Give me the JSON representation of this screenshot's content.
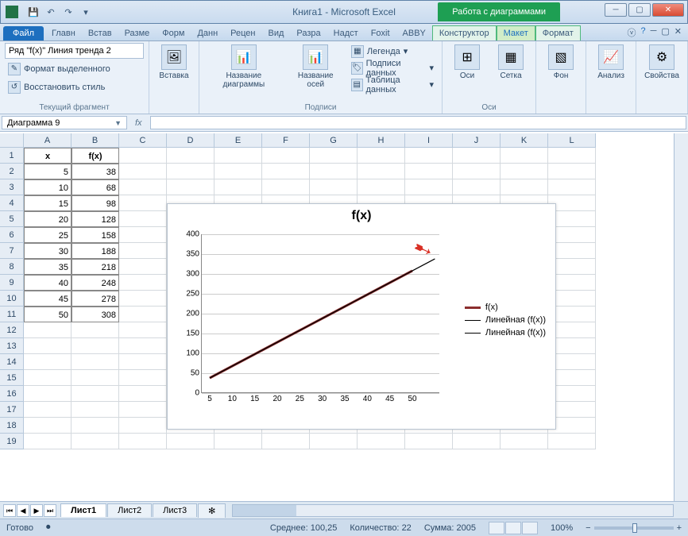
{
  "window": {
    "book": "Книга1",
    "app": "Microsoft Excel",
    "chart_tools": "Работа с диаграммами"
  },
  "tabs": {
    "file": "Файл",
    "list": [
      "Главн",
      "Встав",
      "Разме",
      "Форм",
      "Данн",
      "Рецен",
      "Вид",
      "Разра",
      "Надст",
      "Foxit",
      "ABBY"
    ],
    "chart": [
      "Конструктор",
      "Макет",
      "Формат"
    ],
    "active": "Макет"
  },
  "ribbon": {
    "sel_value": "Ряд \"f(x)\" Линия тренда 2",
    "format_sel": "Формат выделенного",
    "reset_style": "Восстановить стиль",
    "g1": "Текущий фрагмент",
    "insert": "Вставка",
    "chart_name": "Название диаграммы",
    "axes_name": "Название осей",
    "legend": "Легенда",
    "data_labels": "Подписи данных",
    "data_table": "Таблица данных",
    "g2": "Подписи",
    "axes": "Оси",
    "grid": "Сетка",
    "g3": "Оси",
    "bg": "Фон",
    "analysis": "Анализ",
    "props": "Свойства"
  },
  "namebox": "Диаграмма 9",
  "fx": "fx",
  "cols": [
    "A",
    "B",
    "C",
    "D",
    "E",
    "F",
    "G",
    "H",
    "I",
    "J",
    "K",
    "L"
  ],
  "rows": [
    "1",
    "2",
    "3",
    "4",
    "5",
    "6",
    "7",
    "8",
    "9",
    "10",
    "11",
    "12",
    "13",
    "14",
    "15",
    "16",
    "17",
    "18",
    "19"
  ],
  "table": {
    "h1": "x",
    "h2": "f(x)",
    "data": [
      [
        5,
        38
      ],
      [
        10,
        68
      ],
      [
        15,
        98
      ],
      [
        20,
        128
      ],
      [
        25,
        158
      ],
      [
        30,
        188
      ],
      [
        35,
        218
      ],
      [
        40,
        248
      ],
      [
        45,
        278
      ],
      [
        50,
        308
      ]
    ]
  },
  "chart_data": {
    "type": "line",
    "title": "f(x)",
    "x": [
      5,
      10,
      15,
      20,
      25,
      30,
      35,
      40,
      45,
      50
    ],
    "series": [
      {
        "name": "f(x)",
        "values": [
          38,
          68,
          98,
          128,
          158,
          188,
          218,
          248,
          278,
          308
        ],
        "color": "#8b2e2e",
        "width": 3
      },
      {
        "name": "Линейная (f(x))",
        "values": [
          38,
          68,
          98,
          128,
          158,
          188,
          218,
          248,
          278,
          308,
          338
        ],
        "color": "#000",
        "width": 1
      },
      {
        "name": "Линейная (f(x))",
        "values": [
          38,
          68,
          98,
          128,
          158,
          188,
          218,
          248,
          278,
          308,
          338
        ],
        "color": "#000",
        "width": 1
      }
    ],
    "y_ticks": [
      0,
      50,
      100,
      150,
      200,
      250,
      300,
      350,
      400
    ],
    "x_ticks": [
      5,
      10,
      15,
      20,
      25,
      30,
      35,
      40,
      45,
      50
    ],
    "ylim": [
      0,
      400
    ]
  },
  "sheets": {
    "list": [
      "Лист1",
      "Лист2",
      "Лист3"
    ],
    "active": "Лист1"
  },
  "status": {
    "ready": "Готово",
    "avg_lbl": "Среднее:",
    "avg": "100,25",
    "count_lbl": "Количество:",
    "count": "22",
    "sum_lbl": "Сумма:",
    "sum": "2005",
    "zoom": "100%"
  }
}
